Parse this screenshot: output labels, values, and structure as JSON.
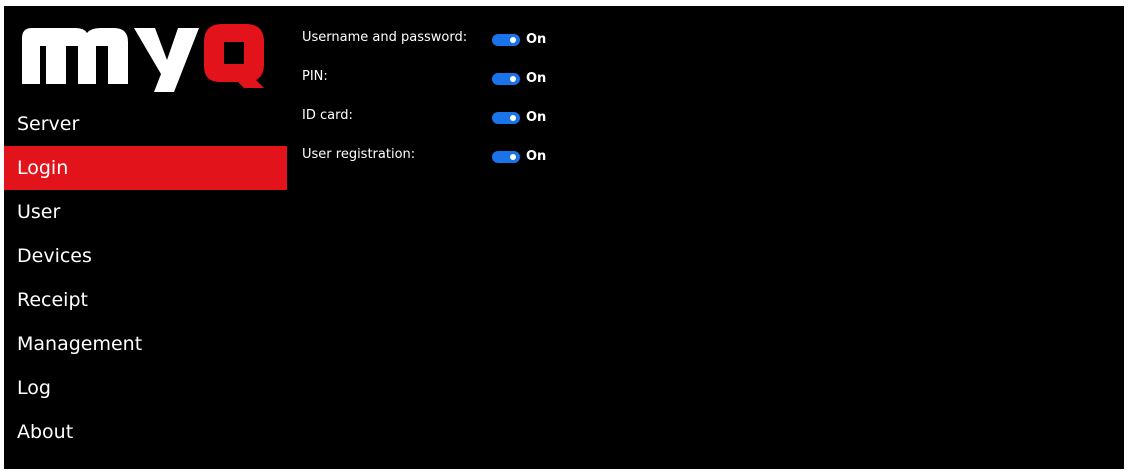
{
  "brand": {
    "logo_text": "myQ",
    "accent_color": "#e3131b",
    "toggle_on_color": "#1a73e8",
    "background_color": "#000000"
  },
  "sidebar": {
    "items": [
      {
        "label": "Server",
        "active": false
      },
      {
        "label": "Login",
        "active": true
      },
      {
        "label": "User",
        "active": false
      },
      {
        "label": "Devices",
        "active": false
      },
      {
        "label": "Receipt",
        "active": false
      },
      {
        "label": "Management",
        "active": false
      },
      {
        "label": "Log",
        "active": false
      },
      {
        "label": "About",
        "active": false
      }
    ]
  },
  "settings": [
    {
      "label": "Username and password:",
      "state": "On",
      "enabled": true
    },
    {
      "label": "PIN:",
      "state": "On",
      "enabled": true
    },
    {
      "label": "ID card:",
      "state": "On",
      "enabled": true
    },
    {
      "label": "User registration:",
      "state": "On",
      "enabled": true
    }
  ]
}
